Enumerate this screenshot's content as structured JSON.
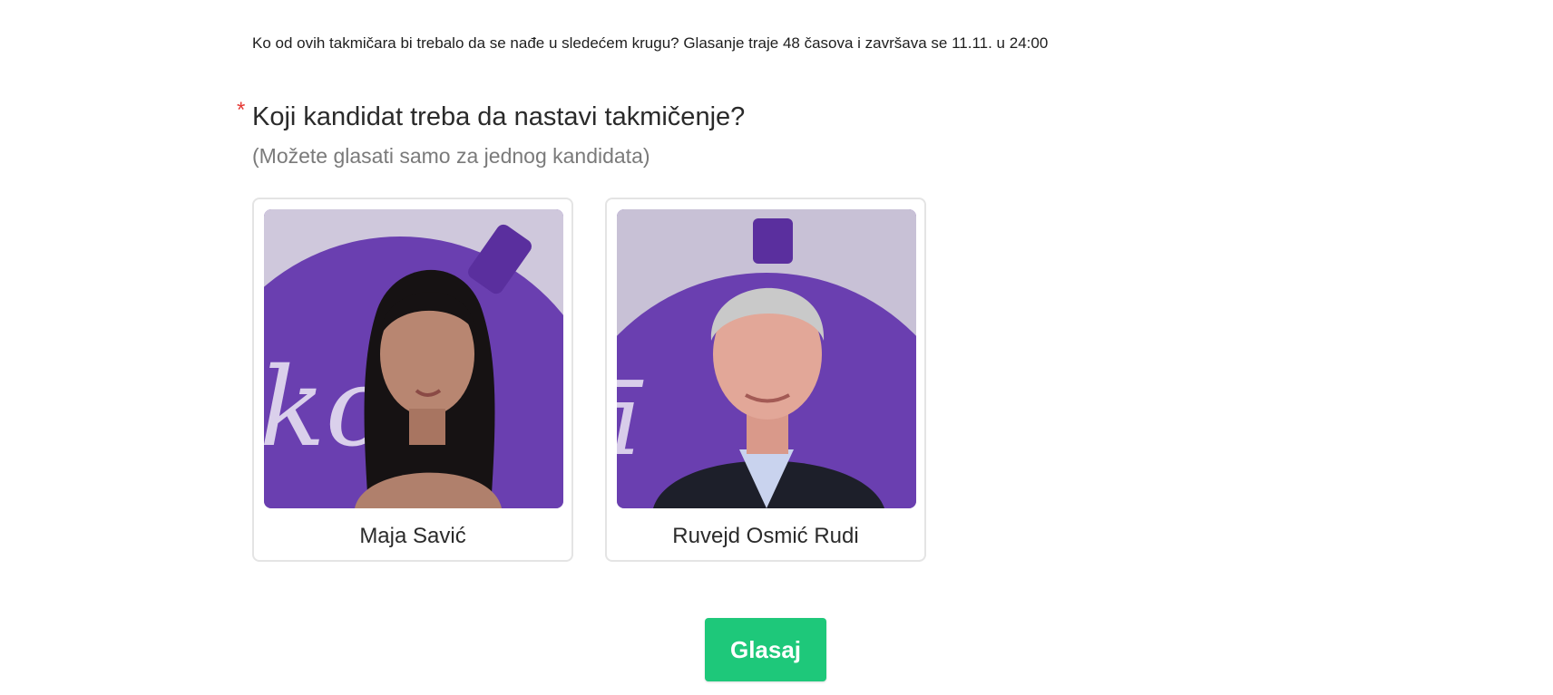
{
  "poll": {
    "intro": "Ko od ovih takmičara bi trebalo da se nađe u sledećem krugu? Glasanje traje 48 časova i završava se 11.11. u 24:00",
    "required_mark": "*",
    "question": "Koji kandidat treba da nastavi takmičenje?",
    "hint": "(Možete glasati samo za jednog kandidata)",
    "candidates": [
      {
        "name": "Maja Savić"
      },
      {
        "name": "Ruvejd Osmić Rudi"
      }
    ],
    "submit_label": "Glasaj"
  },
  "colors": {
    "accent": "#1ec87a",
    "required": "#e53935",
    "backdrop_purple": "#6d3fb3"
  }
}
